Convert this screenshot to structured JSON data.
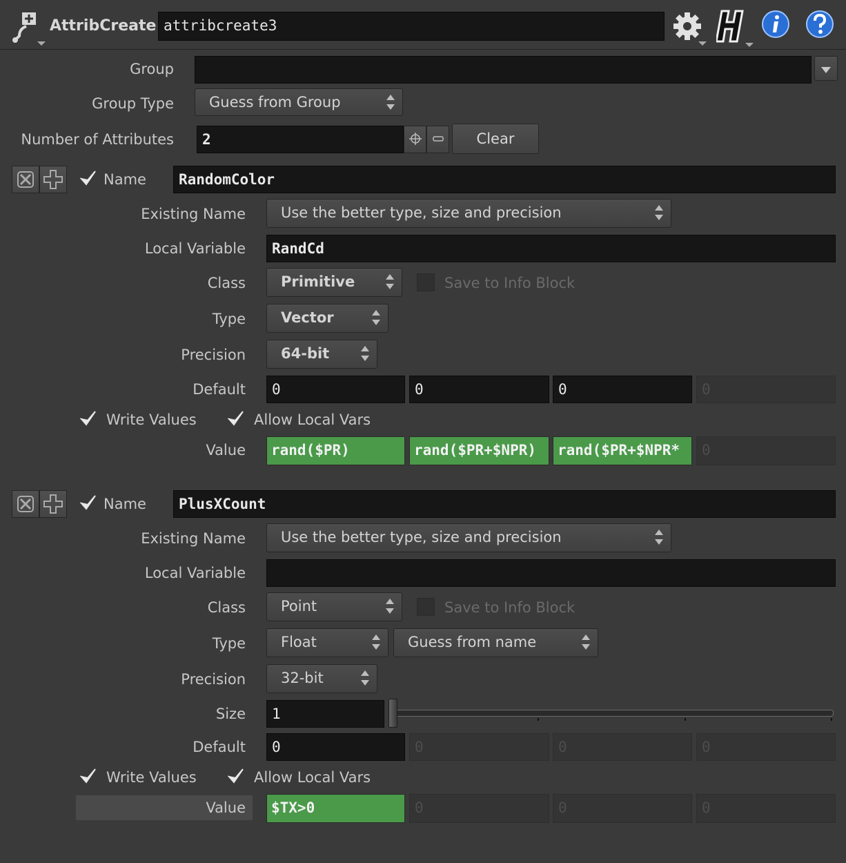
{
  "header": {
    "node_type": "AttribCreate",
    "node_name": "attribcreate3"
  },
  "top": {
    "group_label": "Group",
    "group_value": "",
    "group_type_label": "Group Type",
    "group_type_value": "Guess from Group",
    "num_attr_label": "Number of Attributes",
    "num_attr_value": "2",
    "clear_label": "Clear"
  },
  "attr1": {
    "name_label": "Name",
    "name_value": "RandomColor",
    "existing_name_label": "Existing Name",
    "existing_name_value": "Use the better type, size and precision",
    "local_var_label": "Local Variable",
    "local_var_value": "RandCd",
    "class_label": "Class",
    "class_value": "Primitive",
    "save_info_label": "Save to Info Block",
    "type_label": "Type",
    "type_value": "Vector",
    "precision_label": "Precision",
    "precision_value": "64-bit",
    "default_label": "Default",
    "default_values": [
      "0",
      "0",
      "0",
      "0"
    ],
    "write_values_label": "Write Values",
    "allow_local_vars_label": "Allow Local Vars",
    "value_label": "Value",
    "values": [
      "rand($PR)",
      "rand($PR+$NPR)",
      "rand($PR+$NPR*",
      "0"
    ]
  },
  "attr2": {
    "name_label": "Name",
    "name_value": "PlusXCount",
    "existing_name_label": "Existing Name",
    "existing_name_value": "Use the better type, size and precision",
    "local_var_label": "Local Variable",
    "local_var_value": "",
    "class_label": "Class",
    "class_value": "Point",
    "save_info_label": "Save to Info Block",
    "type_label": "Type",
    "type_value": "Float",
    "typeinfo_value": "Guess from name",
    "precision_label": "Precision",
    "precision_value": "32-bit",
    "size_label": "Size",
    "size_value": "1",
    "default_label": "Default",
    "default_values": [
      "0",
      "0",
      "0",
      "0"
    ],
    "write_values_label": "Write Values",
    "allow_local_vars_label": "Allow Local Vars",
    "value_label": "Value",
    "values": [
      "$TX>0",
      "0",
      "0",
      "0"
    ]
  },
  "icons": {
    "node": "attribcreate-node-icon",
    "gear": "gear-icon",
    "houdini": "houdini-help-icon",
    "info": "info-icon",
    "help": "question-icon",
    "remove": "remove-multiparm-icon",
    "add": "add-multiparm-icon",
    "checkbox": "checkmark-icon"
  },
  "colors": {
    "background": "#3a3a3a",
    "field": "#161616",
    "expression": "#4a9a4a",
    "info_blue": "#2a6fd6"
  }
}
